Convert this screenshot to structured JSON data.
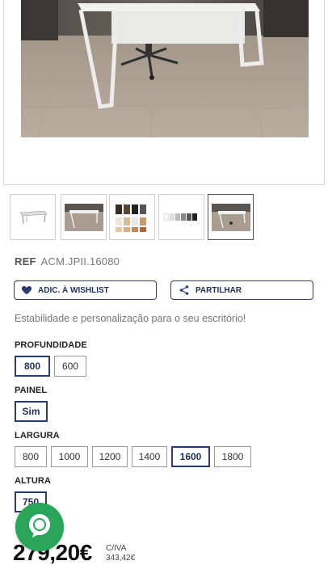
{
  "product": {
    "ref_label": "REF",
    "ref_code": "ACM.JPII.16080",
    "tagline": "Estabilidade e personalização para o seu escritório!"
  },
  "actions": {
    "wishlist_label": "ADIC. À WISHLIST",
    "share_label": "PARTILHAR"
  },
  "gallery": {
    "thumbnails": [
      "desk-render",
      "office-photo",
      "color-swatches",
      "finish-swatches",
      "office-photo-alt"
    ],
    "active_index": 4
  },
  "options": {
    "profundidade": {
      "label": "PROFUNDIDADE",
      "values": [
        "800",
        "600"
      ],
      "selected": "800"
    },
    "painel": {
      "label": "PAINEL",
      "values": [
        "Sim"
      ],
      "selected": "Sim"
    },
    "largura": {
      "label": "LARGURA",
      "values": [
        "800",
        "1000",
        "1200",
        "1400",
        "1600",
        "1800"
      ],
      "selected": "1600"
    },
    "altura": {
      "label": "ALTURA",
      "values": [
        "750"
      ],
      "selected": "750"
    }
  },
  "price": {
    "main": "279,20€",
    "tax_label": "C/IVA",
    "with_tax": "343,42€"
  },
  "colors": {
    "accent": "#2b3d6b",
    "chat": "#2aa55a"
  }
}
